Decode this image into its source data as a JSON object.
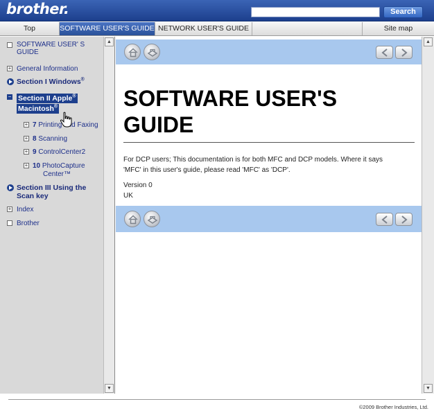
{
  "header": {
    "logo": "brother.",
    "search_value": "",
    "search_button": "Search"
  },
  "tabs": [
    {
      "label": "Top",
      "active": false
    },
    {
      "label": "SOFTWARE USER'S GUIDE",
      "active": true
    },
    {
      "label": "NETWORK USER'S GUIDE",
      "active": false
    },
    {
      "label": "Site map",
      "active": false
    }
  ],
  "sidebar": {
    "items": [
      {
        "label": "SOFTWARE USER' S GUIDE",
        "marker": "box"
      },
      {
        "label": "General Information",
        "marker": "plus"
      },
      {
        "label": "Section I Windows",
        "sup": "®",
        "marker": "dot"
      },
      {
        "label": "Section II Apple",
        "sup": "®",
        "label2": "Macintosh",
        "sup2": "®",
        "marker": "minus"
      },
      {
        "num": "7",
        "label": "Printing and Faxing",
        "marker": "plus"
      },
      {
        "num": "8",
        "label": "Scanning",
        "marker": "plus"
      },
      {
        "num": "9",
        "label": "ControlCenter2",
        "marker": "plus"
      },
      {
        "num": "10",
        "label": "PhotoCapture",
        "label2": "Center™",
        "marker": "plus"
      },
      {
        "label": "Section III Using the",
        "label2": "Scan key",
        "marker": "dot"
      },
      {
        "label": "Index",
        "marker": "plus"
      },
      {
        "label": "Brother",
        "marker": "box"
      }
    ]
  },
  "main": {
    "title_line1": "SOFTWARE USER'S",
    "title_line2": "GUIDE",
    "para1_line1": "For DCP users; This documentation is for both MFC and DCP models. Where it says",
    "para1_line2": "'MFC' in this user's guide, please read 'MFC' as 'DCP'.",
    "version": "Version 0",
    "region": "UK"
  },
  "footer": {
    "copyright": "©2009 Brother Industries, Ltd."
  },
  "colors": {
    "header_blue": "#2a4f9e",
    "nav_band": "#a8c8ee",
    "sidebar_bg": "#d9d9d9",
    "link": "#1d2f8a"
  }
}
